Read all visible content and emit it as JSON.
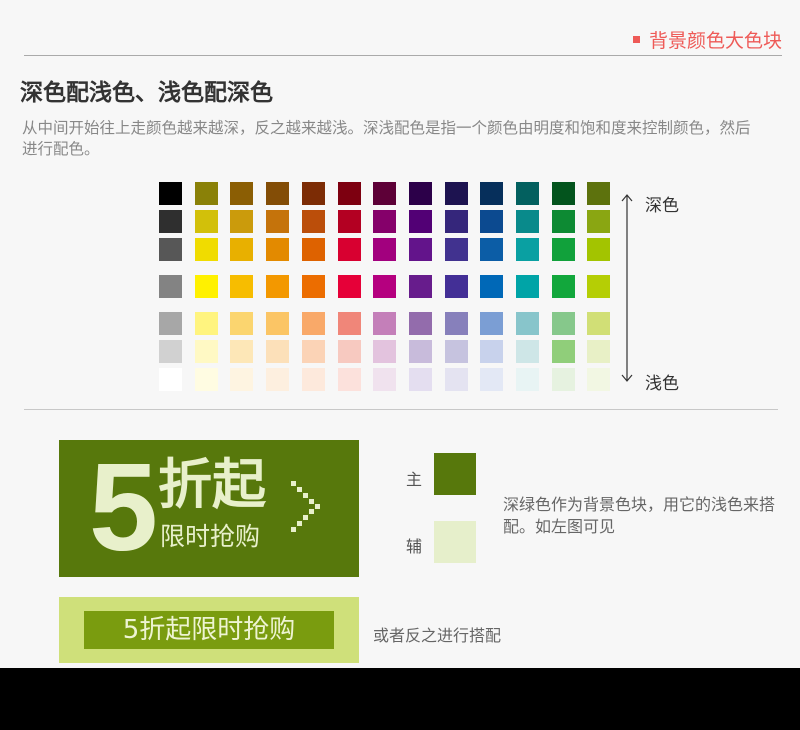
{
  "header": {
    "section_tag": "背景颜色大色块",
    "accent_color": "#ee5a57"
  },
  "title": "深色配浅色、浅色配深色",
  "description": "从中间开始往上走颜色越来越深，反之越来越浅。深浅配色是指一个颜色由明度和饱和度来控制颜色，然后进行配色。",
  "scale": {
    "dark_label": "深色",
    "light_label": "浅色"
  },
  "palette_rows": [
    [
      "#000000",
      "#8a8108",
      "#8b5e04",
      "#834d06",
      "#7c2c05",
      "#7d0010",
      "#5d0037",
      "#2c0049",
      "#1d1350",
      "#062f5b",
      "#03605f",
      "#03541d",
      "#5d720d"
    ],
    [
      "#2f2f2f",
      "#d2c00a",
      "#cb9b0c",
      "#c5730b",
      "#bb4e0a",
      "#b30022",
      "#85006a",
      "#520075",
      "#35267b",
      "#0c4a90",
      "#098a8b",
      "#0d8a33",
      "#8aa612"
    ],
    [
      "#575757",
      "#f0dc00",
      "#e8b000",
      "#e38a00",
      "#de6200",
      "#d80030",
      "#a2007e",
      "#63148b",
      "#41328f",
      "#0c5da6",
      "#0aa0a2",
      "#11a13b",
      "#a3c400"
    ],
    [
      "#838383",
      "#fff100",
      "#f7bd00",
      "#f39800",
      "#ec6d00",
      "#e60038",
      "#b5007f",
      "#671c8c",
      "#432f96",
      "#0068b7",
      "#00a4a7",
      "#12a73c",
      "#b5ce05"
    ],
    [
      "#a7a7a7",
      "#fff47f",
      "#fbd56f",
      "#fbc565",
      "#f9a969",
      "#f08679",
      "#c47fb9",
      "#936cac",
      "#8780bb",
      "#7b9ed4",
      "#88c5cb",
      "#86c88b",
      "#d1df76"
    ],
    [
      "#d1d1d1",
      "#fff9c4",
      "#fde7b7",
      "#fce0b9",
      "#fbd3b6",
      "#f7c9c0",
      "#e3c3de",
      "#c8bbdb",
      "#c6c3df",
      "#c8d2ec",
      "#cee6e7",
      "#90ce7a",
      "#e8f0c6"
    ],
    [
      "#ffffff",
      "#fffce2",
      "#fef4e1",
      "#fdefdf",
      "#fde9dc",
      "#fce1dc",
      "#f0e2ee",
      "#e4def0",
      "#e4e3f1",
      "#e3e8f5",
      "#e8f4f4",
      "#e6f2e0",
      "#f2f7e3"
    ]
  ],
  "example": {
    "banner_number": "5",
    "banner_big": "折起",
    "banner_small": "限时抢购",
    "main_label": "主",
    "aux_label": "辅",
    "main_color": "#57780c",
    "aux_color": "#e6efcb",
    "note": "深绿色作为背景色块，用它的浅色来搭配。如左图可见"
  },
  "example2": {
    "banner_text": "5折起限时抢购",
    "note": "或者反之进行搭配",
    "outer_color": "#cfe07a",
    "inner_color": "#7a9c0f"
  }
}
